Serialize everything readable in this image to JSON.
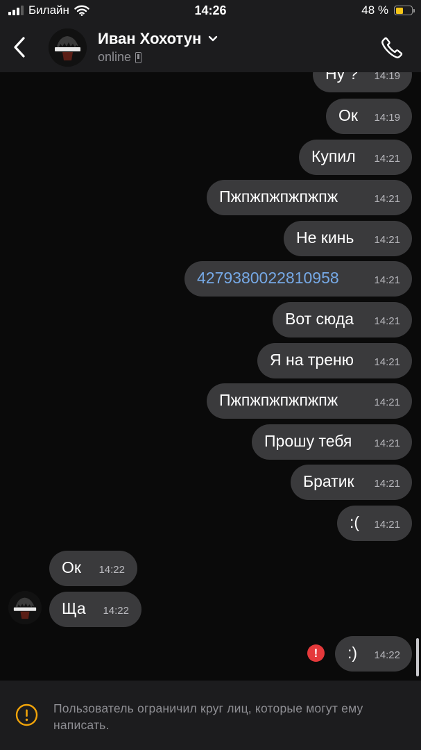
{
  "status_bar": {
    "carrier": "Билайн",
    "time": "14:26",
    "battery_percent": "48 %",
    "battery_level": 0.48,
    "signal_bars": 3,
    "signal_bars_total": 4
  },
  "header": {
    "contact_name": "Иван Хохотун",
    "status": "online"
  },
  "messages": [
    {
      "direction": "out",
      "text": "Ну ?",
      "time": "14:19"
    },
    {
      "direction": "out",
      "text": "Ок",
      "time": "14:19"
    },
    {
      "direction": "out",
      "text": "Купил",
      "time": "14:21"
    },
    {
      "direction": "out",
      "text": "Пжпжпжпжпжпж",
      "time": "14:21"
    },
    {
      "direction": "out",
      "text": "Не кинь",
      "time": "14:21"
    },
    {
      "direction": "out",
      "text": "4279380022810958",
      "time": "14:21",
      "is_link": true
    },
    {
      "direction": "out",
      "text": "Вот сюда",
      "time": "14:21"
    },
    {
      "direction": "out",
      "text": "Я на треню",
      "time": "14:21"
    },
    {
      "direction": "out",
      "text": "Пжпжпжпжпжпж",
      "time": "14:21"
    },
    {
      "direction": "out",
      "text": "Прошу тебя",
      "time": "14:21"
    },
    {
      "direction": "out",
      "text": "Братик",
      "time": "14:21"
    },
    {
      "direction": "out",
      "text": ":(",
      "time": "14:21"
    },
    {
      "direction": "in",
      "text": "Ок",
      "time": "14:22"
    },
    {
      "direction": "in",
      "text": "Ща",
      "time": "14:22"
    },
    {
      "direction": "out",
      "text": ":)",
      "time": "14:22",
      "failed": true
    }
  ],
  "notice": {
    "text": "Пользователь ограничил круг лиц, которые могут ему написать."
  },
  "icons": {
    "back": "chevron-left-icon",
    "dropdown": "chevron-down-icon",
    "call": "phone-icon",
    "error": "exclamation-icon",
    "warning": "warning-circle-icon"
  },
  "colors": {
    "background": "#0a0a0a",
    "bar_background": "#1c1c1e",
    "bubble": "#3a3a3c",
    "link": "#76a9e6",
    "error": "#e5393b",
    "battery": "#f5c518",
    "muted_text": "#8e8e93"
  }
}
